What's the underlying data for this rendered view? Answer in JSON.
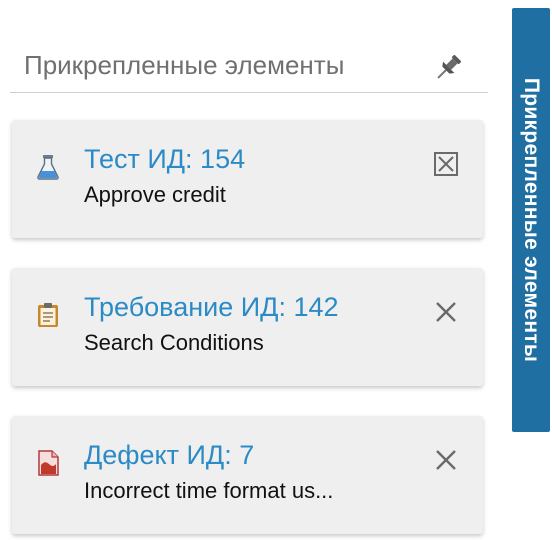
{
  "panel": {
    "title": "Прикрепленные элементы",
    "pin_icon": "pin-icon"
  },
  "items": [
    {
      "type": "test",
      "icon": "flask-icon",
      "title": "Тест ИД: 154",
      "description": "Approve credit",
      "close_icon": "close-boxed-icon"
    },
    {
      "type": "requirement",
      "icon": "clipboard-icon",
      "title": "Требование ИД: 142",
      "description": "Search Conditions",
      "close_icon": "close-icon"
    },
    {
      "type": "defect",
      "icon": "defect-document-icon",
      "title": "Дефект ИД: 7",
      "description": "Incorrect time format us...",
      "close_icon": "close-icon"
    }
  ],
  "side_tab": {
    "label": "Прикрепленные элементы"
  },
  "colors": {
    "link": "#2b8bc6",
    "side_tab": "#1f6fa3",
    "card_bg": "#efefef"
  }
}
